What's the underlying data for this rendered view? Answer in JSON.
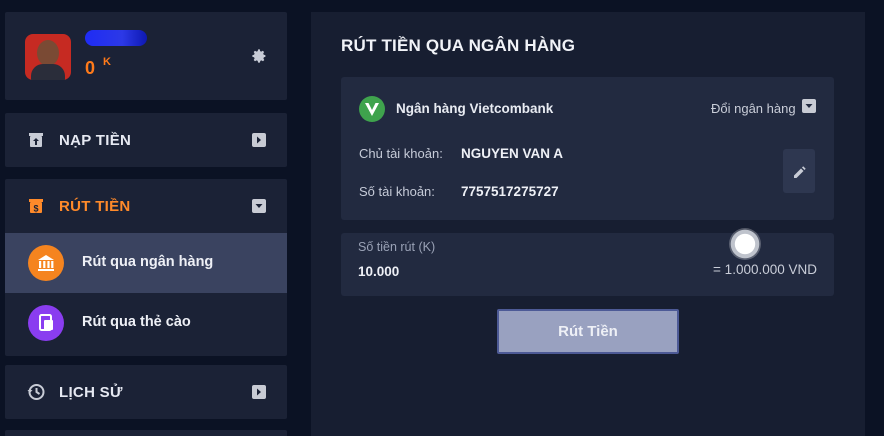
{
  "profile": {
    "balance": "0",
    "balance_unit": "K",
    "avatar_icon": "avatar-icon",
    "settings_icon": "gear-icon"
  },
  "sidebar": {
    "deposit_label": "NẠP TIỀN",
    "withdraw_label": "RÚT TIỀN",
    "withdraw_sub": [
      {
        "label": "Rút qua ngân hàng",
        "icon": "bank-icon",
        "color": "#f5841f",
        "active": true
      },
      {
        "label": "Rút qua thẻ cào",
        "icon": "card-icon",
        "color": "#8a3df0",
        "active": false
      }
    ],
    "history_label": "LỊCH SỬ",
    "accent": "#ff8a2a"
  },
  "main": {
    "title": "RÚT TIỀN QUA NGÂN HÀNG",
    "bank": {
      "name": "Ngân hàng Vietcombank",
      "change_label": "Đổi ngân hàng",
      "holder_label": "Chủ tài khoản:",
      "holder_value": "NGUYEN VAN A",
      "account_label": "Số tài khoản:",
      "account_value": "7757517275727",
      "logo_color": "#3fa34d"
    },
    "amount": {
      "placeholder": "Số tiền rút (K)",
      "value": "10.000",
      "converted": "= 1.000.000 VND"
    },
    "submit_label": "Rút Tiền"
  }
}
